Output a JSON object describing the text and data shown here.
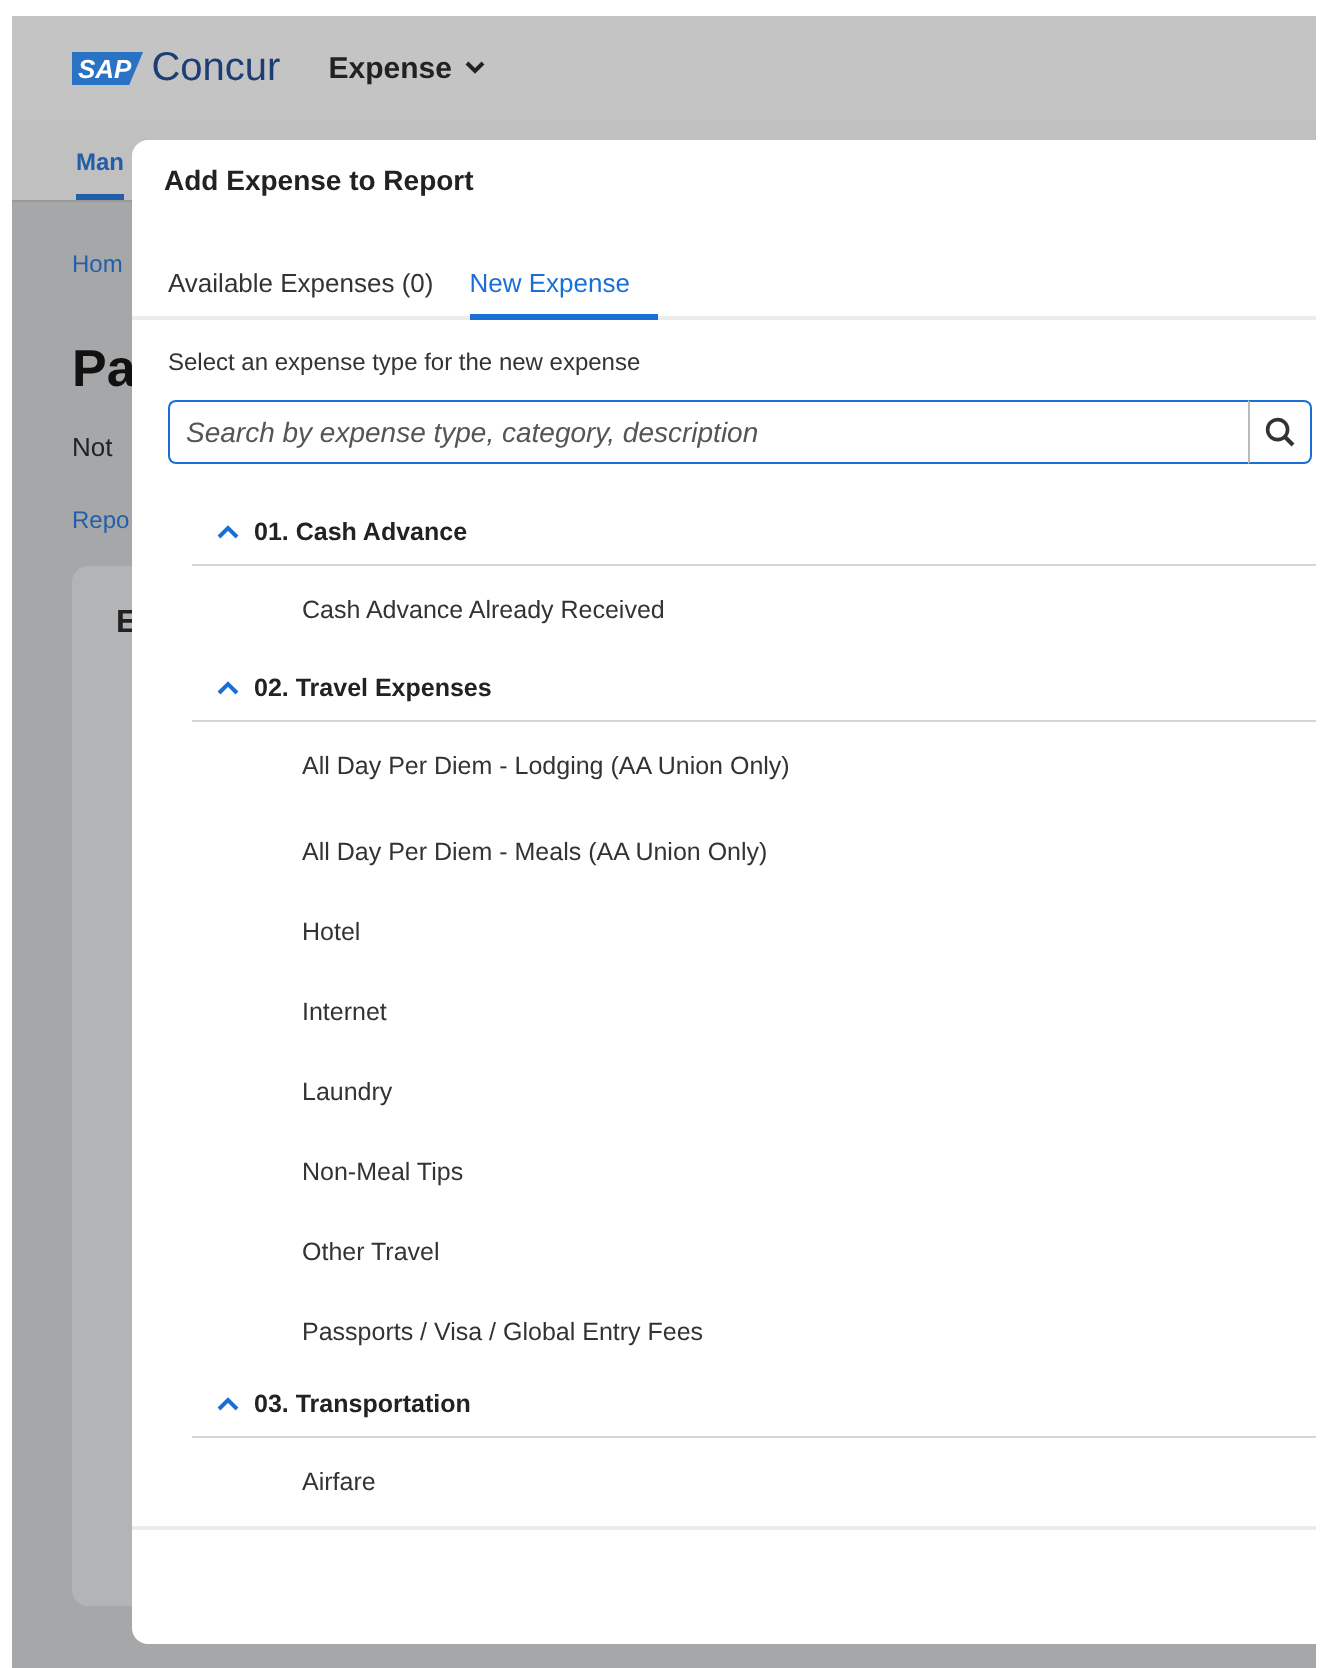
{
  "header": {
    "logo": "SAP",
    "brand": "Concur",
    "menu": "Expense"
  },
  "background": {
    "nav_tab": "Man",
    "breadcrumb": "Hom",
    "page_title": "Pa",
    "status": "Not",
    "link": "Repo",
    "card_title": "E"
  },
  "dialog": {
    "title": "Add Expense to Report",
    "tabs": [
      {
        "label": "Available Expenses (0)",
        "selected": false
      },
      {
        "label": "New Expense",
        "selected": true
      }
    ],
    "instruction": "Select an expense type for the new expense",
    "search": {
      "placeholder": "Search by expense type, category, description"
    },
    "groups": [
      {
        "title": "01. Cash Advance",
        "expanded": true,
        "items": [
          "Cash Advance Already Received"
        ]
      },
      {
        "title": "02. Travel Expenses",
        "expanded": true,
        "items": [
          "All Day Per Diem - Lodging (AA Union Only)",
          "All Day Per Diem - Meals (AA Union Only)",
          "Hotel",
          "Internet",
          "Laundry",
          "Non-Meal Tips",
          "Other Travel",
          "Passports / Visa / Global Entry Fees"
        ]
      },
      {
        "title": "03. Transportation",
        "expanded": true,
        "items": [
          "Airfare"
        ]
      }
    ]
  }
}
